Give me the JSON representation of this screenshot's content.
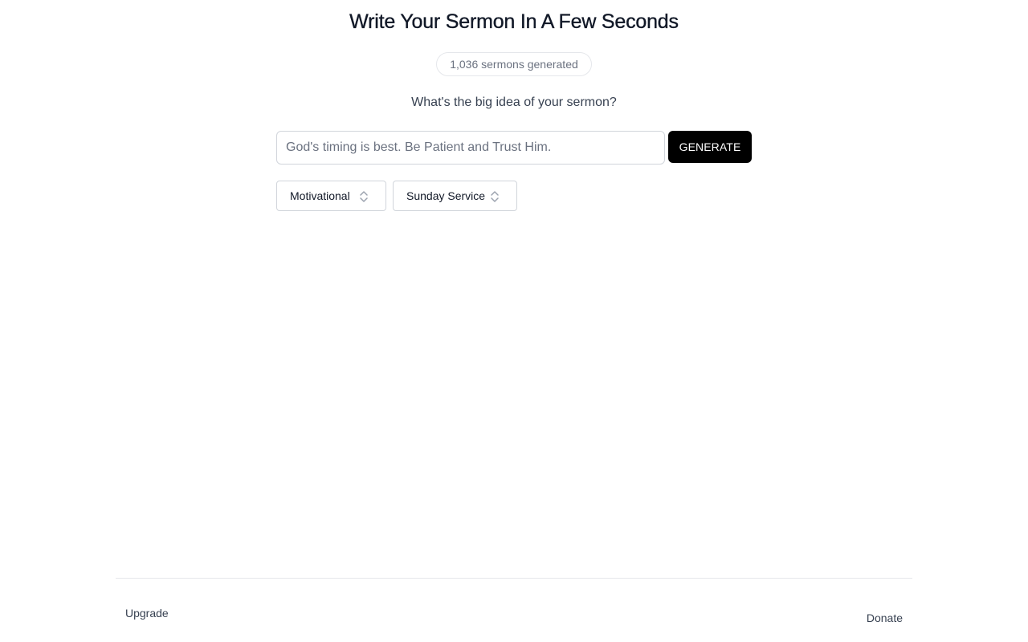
{
  "header": {
    "title": "Write Your Sermon In A Few Seconds",
    "counter": "1,036 sermons generated"
  },
  "form": {
    "question": "What's the big idea of your sermon?",
    "idea_input": {
      "value": "",
      "placeholder": "God's timing is best. Be Patient and Trust Him."
    },
    "generate_label": "GENERATE",
    "tone_select": {
      "selected": "Motivational",
      "icon": "chevron-up-down-icon"
    },
    "occasion_select": {
      "selected": "Sunday Service",
      "icon": "chevron-up-down-icon"
    }
  },
  "footer": {
    "upgrade_label": "Upgrade",
    "donate_label": "Donate"
  },
  "colors": {
    "primary_button": "#000000",
    "border": "#d1d5db",
    "muted_text": "#6b7280"
  }
}
